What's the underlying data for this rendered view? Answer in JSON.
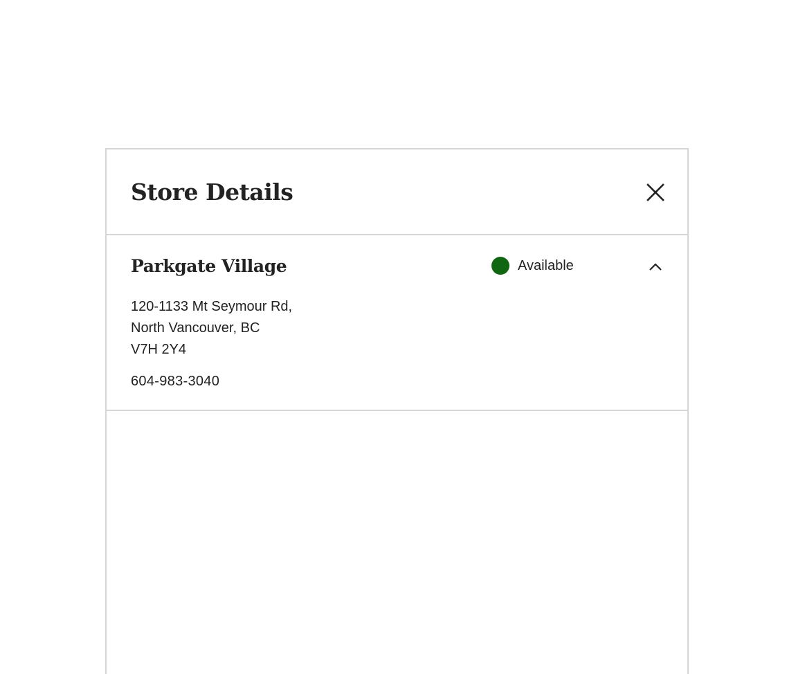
{
  "panel": {
    "title": "Store Details",
    "close_icon": "close-icon"
  },
  "store": {
    "name": "Parkgate Village",
    "status": {
      "label": "Available",
      "color": "#116611"
    },
    "collapse_icon": "chevron-up-icon",
    "address": {
      "line1": "120-1133 Mt Seymour Rd,",
      "line2": "North Vancouver, BC",
      "line3": "V7H 2Y4"
    },
    "phone": "604-983-3040"
  }
}
